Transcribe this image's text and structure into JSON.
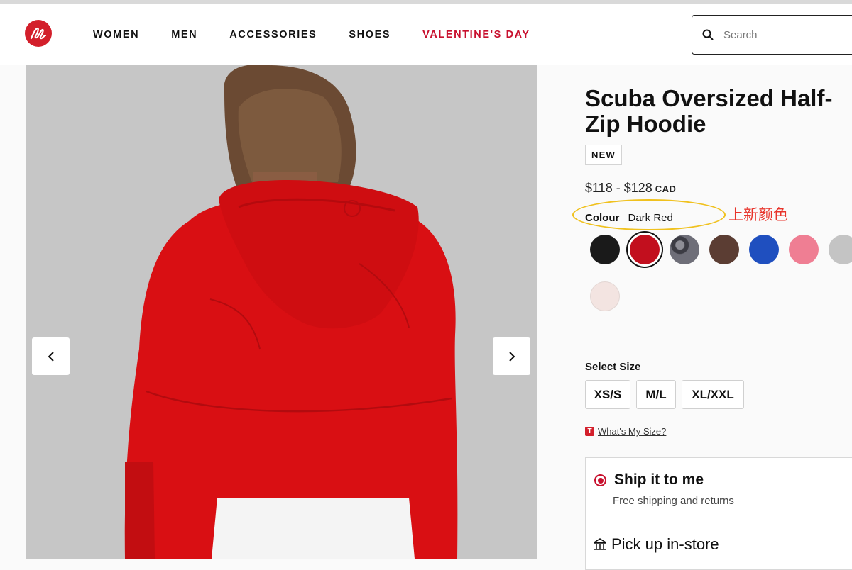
{
  "header": {
    "nav": [
      "WOMEN",
      "MEN",
      "ACCESSORIES",
      "SHOES",
      "VALENTINE'S DAY"
    ],
    "search_placeholder": "Search"
  },
  "product": {
    "title": "Scuba Oversized Half-Zip Hoodie",
    "badge": "NEW",
    "price": "$118 - $128",
    "currency": "CAD",
    "colour_label": "Colour",
    "colour_value": "Dark Red",
    "annotation": "上新颜色",
    "swatches": [
      {
        "name": "black",
        "color": "#1a1a1a",
        "selected": false
      },
      {
        "name": "dark-red",
        "color": "#c20f1e",
        "selected": true
      },
      {
        "name": "camo",
        "color": "#4a4a52",
        "selected": false
      },
      {
        "name": "brown",
        "color": "#5b3d33",
        "selected": false
      },
      {
        "name": "blue",
        "color": "#1f4fbf",
        "selected": false
      },
      {
        "name": "pink",
        "color": "#ef7e93",
        "selected": false
      },
      {
        "name": "heather-grey",
        "color": "#c4c4c4",
        "selected": false
      },
      {
        "name": "cream",
        "color": "#f3e4e1",
        "selected": false
      }
    ],
    "size_label": "Select Size",
    "sizes": [
      "XS/S",
      "M/L",
      "XL/XXL"
    ],
    "size_guide": "What's My Size?",
    "size_guide_icon": "T"
  },
  "delivery": {
    "ship_title": "Ship it to me",
    "ship_sub": "Free shipping and returns",
    "pickup_title": "Pick up in-store"
  }
}
